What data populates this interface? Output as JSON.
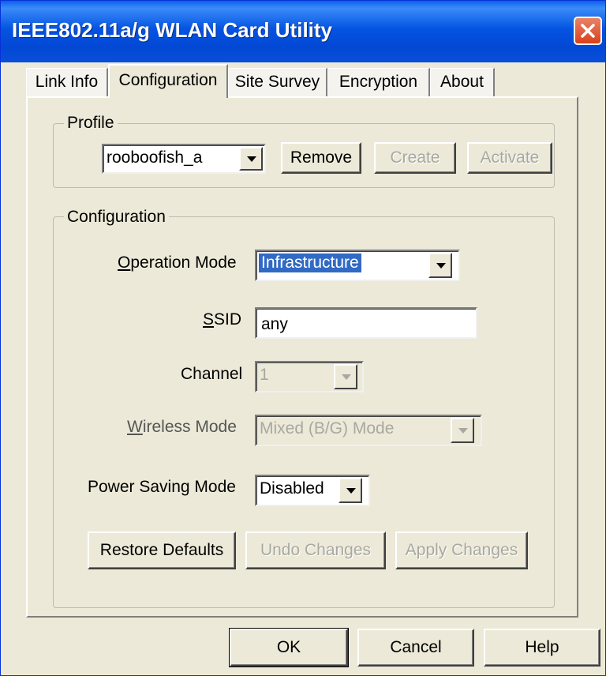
{
  "window": {
    "title": "IEEE802.11a/g WLAN Card Utility"
  },
  "tabs": [
    {
      "label": "Link Info",
      "active": false
    },
    {
      "label": "Configuration",
      "active": true
    },
    {
      "label": "Site Survey",
      "active": false
    },
    {
      "label": "Encryption",
      "active": false
    },
    {
      "label": "About",
      "active": false
    }
  ],
  "profile": {
    "legend": "Profile",
    "selected": "rooboofish_a",
    "remove_label": "Remove",
    "create_label": "Create",
    "activate_label": "Activate"
  },
  "configuration": {
    "legend": "Configuration",
    "operation_mode": {
      "label_prefix": "",
      "label_accel": "O",
      "label_rest": "peration Mode",
      "value": "Infrastructure"
    },
    "ssid": {
      "label_accel": "S",
      "label_rest": "SID",
      "value": "any"
    },
    "channel": {
      "label": "Channel",
      "value": "1"
    },
    "wireless_mode": {
      "label_accel": "W",
      "label_rest": "ireless Mode",
      "value": "Mixed (B/G) Mode"
    },
    "power_saving": {
      "label": "Power Saving Mode",
      "value": "Disabled"
    },
    "restore_label": "Restore Defaults",
    "undo_label": "Undo Changes",
    "apply_label": "Apply Changes"
  },
  "footer": {
    "ok_label": "OK",
    "cancel_label": "Cancel",
    "help_label": "Help"
  },
  "icons": {
    "close": "close-icon",
    "dropdown": "chevron-down-icon"
  },
  "colors": {
    "titlebar": "#0554e2",
    "close_button": "#d8411c",
    "selection": "#316ac5",
    "dialog_bg": "#ece9d8"
  }
}
